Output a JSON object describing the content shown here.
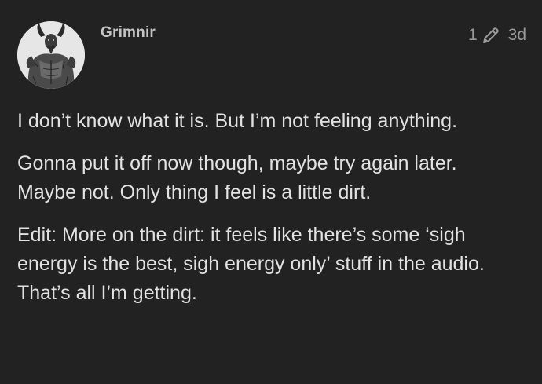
{
  "post": {
    "username": "Grimnir",
    "edit_count": "1",
    "date": "3d",
    "avatar_icon": "avatar-goat-demon-illustration",
    "edit_icon": "pencil-icon",
    "paragraphs": [
      "I don’t know what it is. But I’m not feeling anything.",
      "Gonna put it off now though, maybe try again later. Maybe not. Only thing I feel is a little dirt.",
      "Edit: More on the dirt: it feels like there’s some ‘sigh energy is the best, sigh energy only’ stuff in the audio. That’s all I’m getting."
    ]
  },
  "colors": {
    "background": "#222222",
    "text": "#e2e2e2",
    "username": "#c4c4c4",
    "meta": "#9a9a9a"
  }
}
